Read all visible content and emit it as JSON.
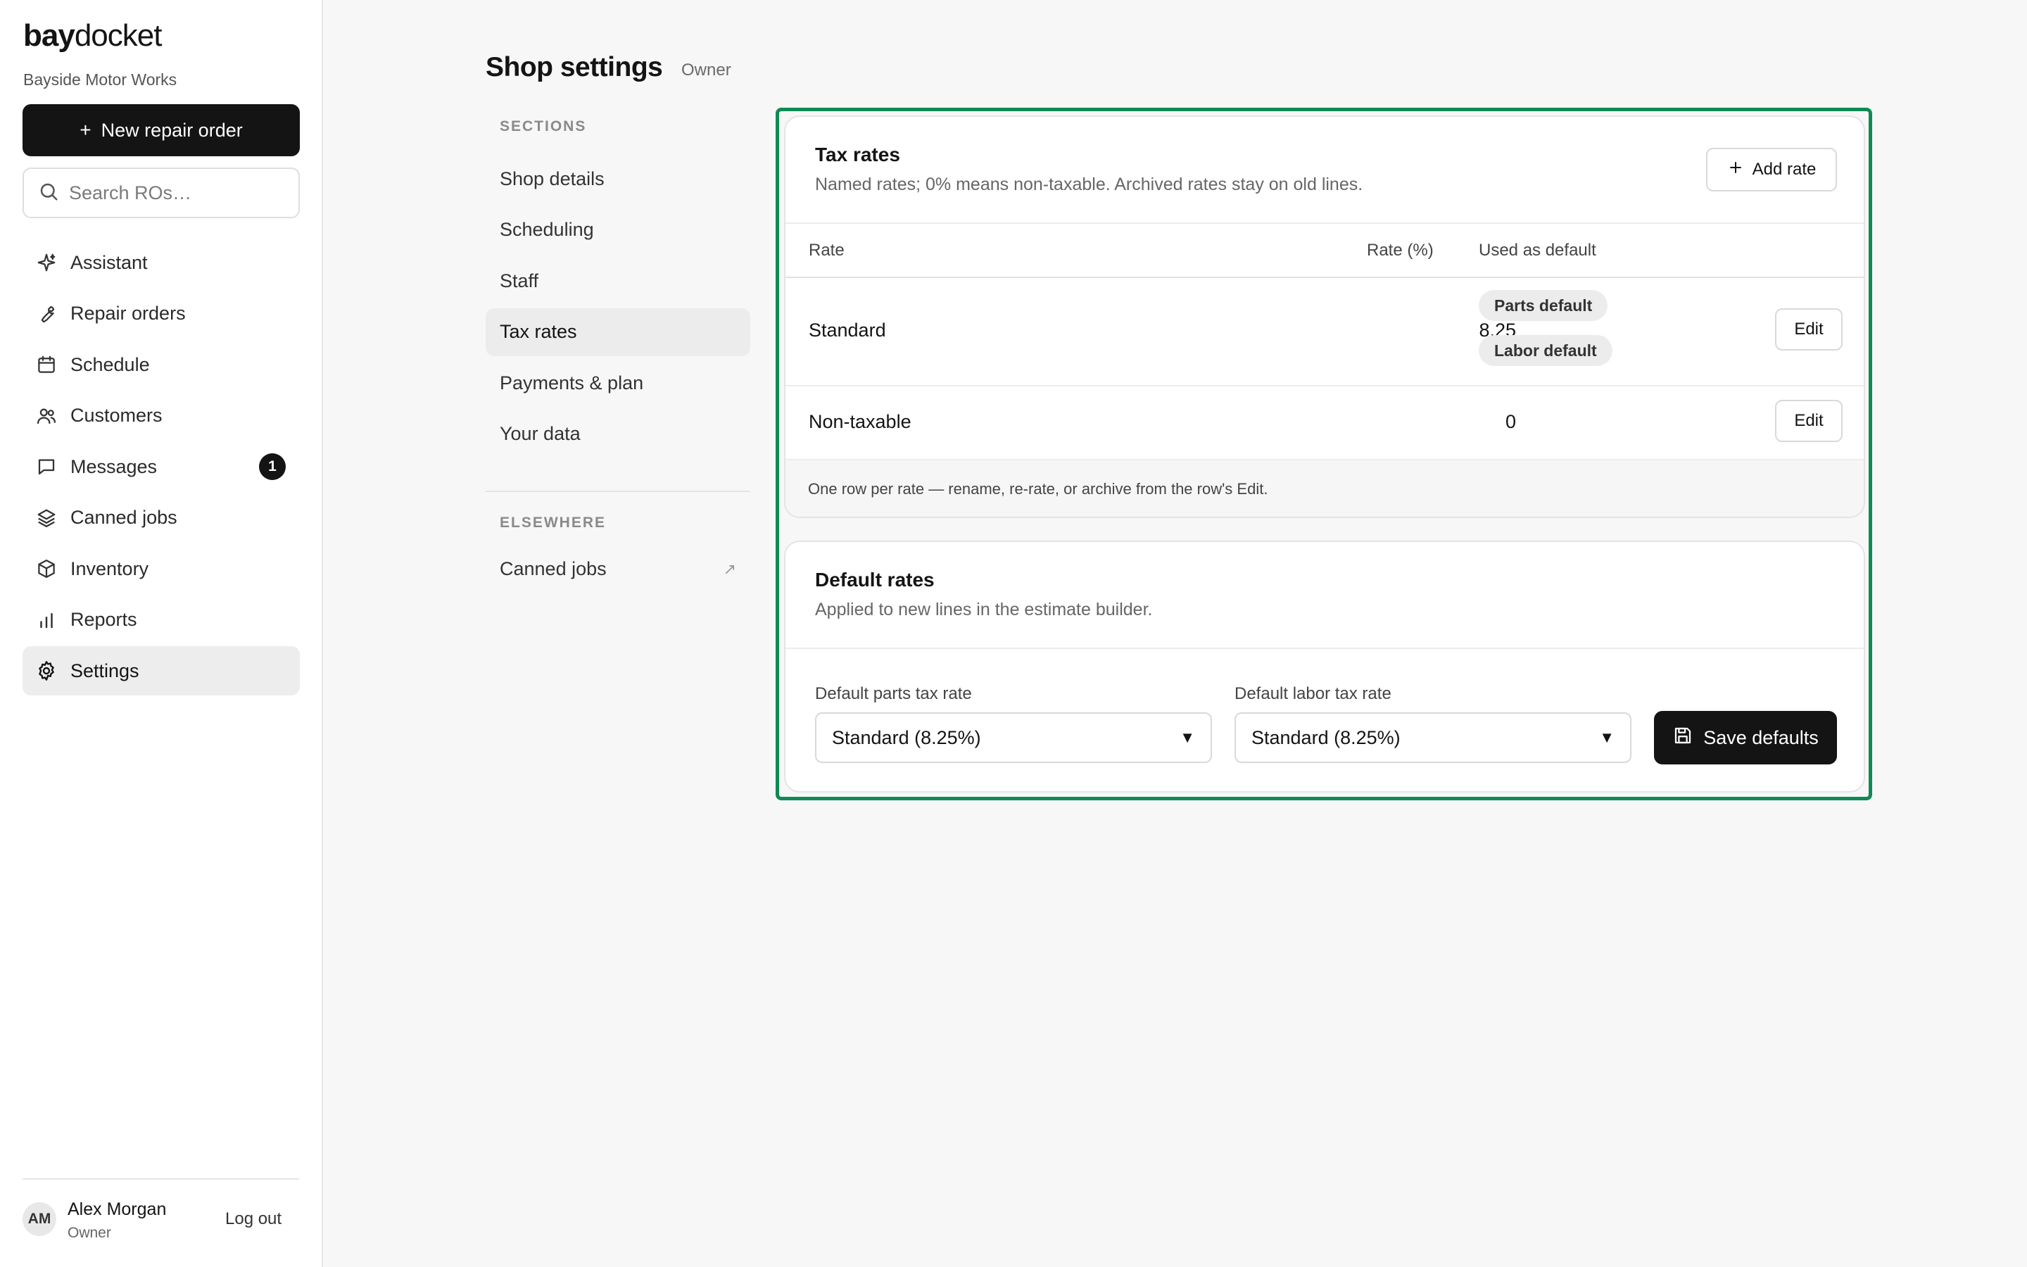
{
  "app": {
    "logo_bold": "bay",
    "logo_regular": "docket",
    "shop_name": "Bayside Motor Works",
    "new_ro_label": "New repair order",
    "search_placeholder": "Search ROs…"
  },
  "sidebar": {
    "items": [
      {
        "label": "Assistant",
        "icon": "sparkle-icon"
      },
      {
        "label": "Repair orders",
        "icon": "wrench-icon"
      },
      {
        "label": "Schedule",
        "icon": "calendar-icon"
      },
      {
        "label": "Customers",
        "icon": "users-icon"
      },
      {
        "label": "Messages",
        "icon": "message-icon",
        "badge": "1"
      },
      {
        "label": "Canned jobs",
        "icon": "layers-icon"
      },
      {
        "label": "Inventory",
        "icon": "box-icon"
      },
      {
        "label": "Reports",
        "icon": "bar-chart-icon"
      },
      {
        "label": "Settings",
        "icon": "gear-icon",
        "active": true
      }
    ],
    "user": {
      "initials": "AM",
      "name": "Alex Morgan",
      "role": "Owner",
      "logout_label": "Log out"
    }
  },
  "header": {
    "title": "Shop settings",
    "role": "Owner"
  },
  "sections_nav": {
    "heading": "SECTIONS",
    "items": [
      "Shop details",
      "Scheduling",
      "Staff",
      "Tax rates",
      "Payments & plan",
      "Your data"
    ],
    "active": "Tax rates",
    "elsewhere_heading": "ELSEWHERE",
    "elsewhere_items": [
      "Canned jobs"
    ]
  },
  "tax_rates": {
    "title": "Tax rates",
    "subtitle": "Named rates; 0% means non-taxable. Archived rates stay on old lines.",
    "add_label": "Add rate",
    "columns": [
      "Rate",
      "Rate (%)",
      "Used as default"
    ],
    "rows": [
      {
        "name": "Standard",
        "rate": "8.25",
        "defaults": [
          "Parts default",
          "Labor default"
        ],
        "edit_label": "Edit"
      },
      {
        "name": "Non-taxable",
        "rate": "0",
        "defaults": [],
        "edit_label": "Edit"
      }
    ],
    "footnote": "One row per rate — rename, re-rate, or archive from the row's Edit."
  },
  "default_rates": {
    "title": "Default rates",
    "subtitle": "Applied to new lines in the estimate builder.",
    "parts_label": "Default parts tax rate",
    "parts_value": "Standard (8.25%)",
    "labor_label": "Default labor tax rate",
    "labor_value": "Standard (8.25%)",
    "save_label": "Save defaults"
  },
  "colors": {
    "accent_frame": "#0f8a55",
    "primary_dark": "#141414"
  }
}
